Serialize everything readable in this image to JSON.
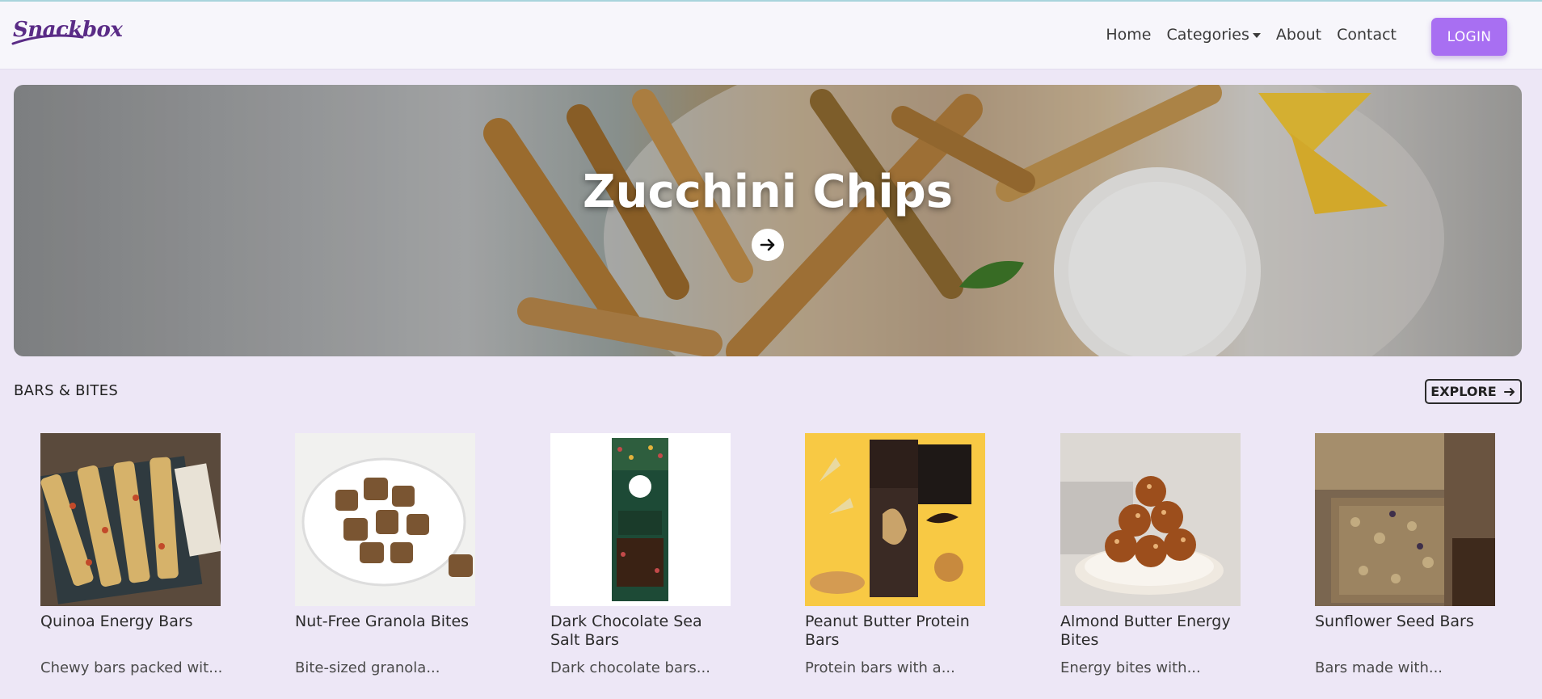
{
  "brand": {
    "logo_text": "Snackbox",
    "accent": "#a86ff2",
    "logo_color": "#5a2b86"
  },
  "nav": {
    "links": [
      {
        "label": "Home"
      },
      {
        "label": "Categories",
        "has_dropdown": true
      },
      {
        "label": "About"
      },
      {
        "label": "Contact"
      }
    ],
    "login_label": "LOGIN"
  },
  "hero": {
    "title": "Zucchini Chips",
    "icon": "arrow-right-icon"
  },
  "section": {
    "title": "BARS & BITES",
    "explore_label": "EXPLORE"
  },
  "products": [
    {
      "name": "Quinoa Energy Bars",
      "desc": "Chewy bars packed wit..."
    },
    {
      "name": "Nut-Free Granola Bites",
      "desc": "Bite-sized granola..."
    },
    {
      "name": "Dark Chocolate Sea Salt Bars",
      "desc": "Dark chocolate bars..."
    },
    {
      "name": "Peanut Butter Protein Bars",
      "desc": "Protein bars with a..."
    },
    {
      "name": "Almond Butter Energy Bites",
      "desc": "Energy bites with..."
    },
    {
      "name": "Sunflower Seed Bars",
      "desc": "Bars made with..."
    }
  ]
}
